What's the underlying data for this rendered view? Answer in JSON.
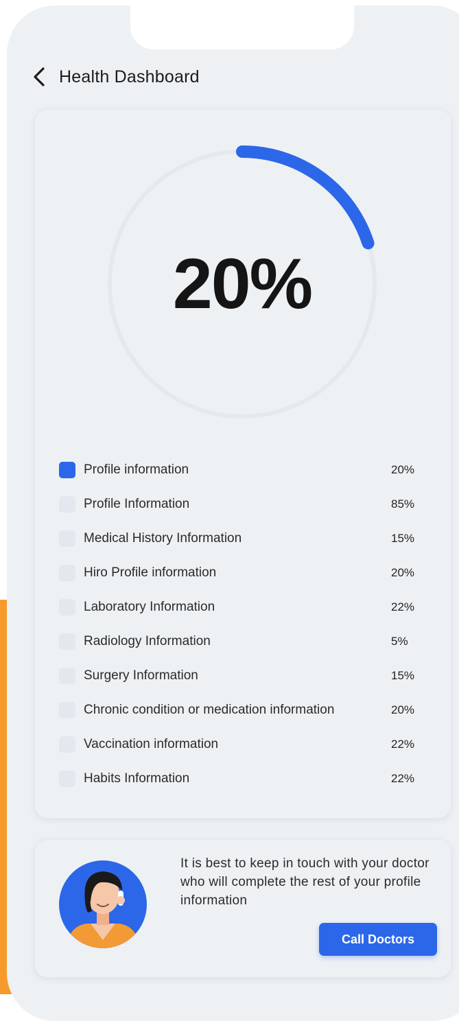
{
  "header": {
    "title": "Health Dashboard"
  },
  "progress": {
    "label": "20%",
    "fraction": 0.2
  },
  "items": [
    {
      "label": "Profile information",
      "value": "20%",
      "checked": true
    },
    {
      "label": "Profile Information",
      "value": "85%",
      "checked": false
    },
    {
      "label": "Medical History Information",
      "value": "15%",
      "checked": false
    },
    {
      "label": "Hiro Profile information",
      "value": "20%",
      "checked": false
    },
    {
      "label": "Laboratory Information",
      "value": "22%",
      "checked": false
    },
    {
      "label": "Radiology Information",
      "value": "5%",
      "checked": false
    },
    {
      "label": "Surgery Information",
      "value": "15%",
      "checked": false
    },
    {
      "label": "Chronic condition or medication information",
      "value": "20%",
      "checked": false
    },
    {
      "label": "Vaccination information",
      "value": "22%",
      "checked": false
    },
    {
      "label": "Habits Information",
      "value": "22%",
      "checked": false
    }
  ],
  "contact": {
    "message": "It is best to keep in touch with your doctor who will complete the rest of your profile information",
    "button_label": "Call Doctors"
  },
  "colors": {
    "accent": "#2b67e8",
    "orange": "#f79a2c",
    "background": "#eef1f4",
    "track": "#e4e8ef"
  },
  "icons": [
    "chevron-left-icon",
    "doctor-avatar"
  ]
}
